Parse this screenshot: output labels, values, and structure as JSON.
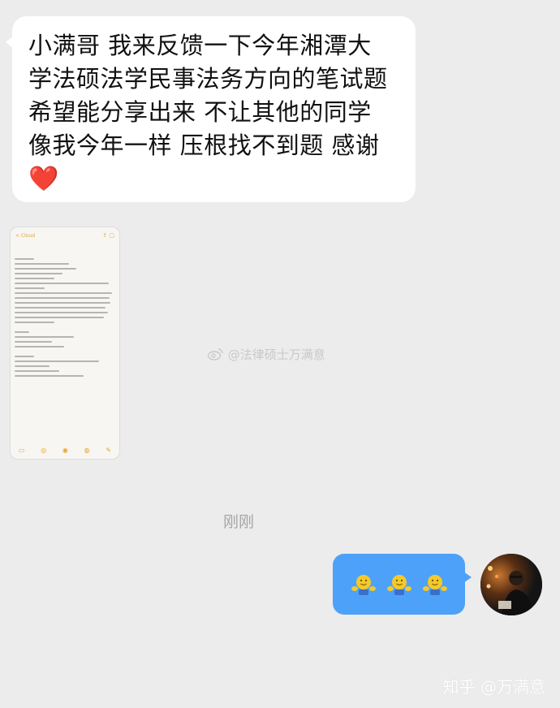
{
  "incoming_message": {
    "text": "小满哥 我来反馈一下今年湘潭大\n学法硕法学民事法务方向的笔试题\n希望能分享出来 不让其他的同学\n像我今年一样 压根找不到题 感谢\n",
    "emoji": "❤️"
  },
  "screenshot_message": {
    "back_label": "< Cloud"
  },
  "watermark": "@法律硕士万满意",
  "timestamp": "刚刚",
  "outgoing_message": {
    "emoji_count": 3,
    "emoji_name": "hug-emoji"
  },
  "footer_watermark": "知乎 @万满意",
  "colors": {
    "background": "#ececec",
    "incoming_bubble": "#ffffff",
    "outgoing_bubble": "#4da1f9",
    "emoji_yellow": "#f5c928"
  }
}
